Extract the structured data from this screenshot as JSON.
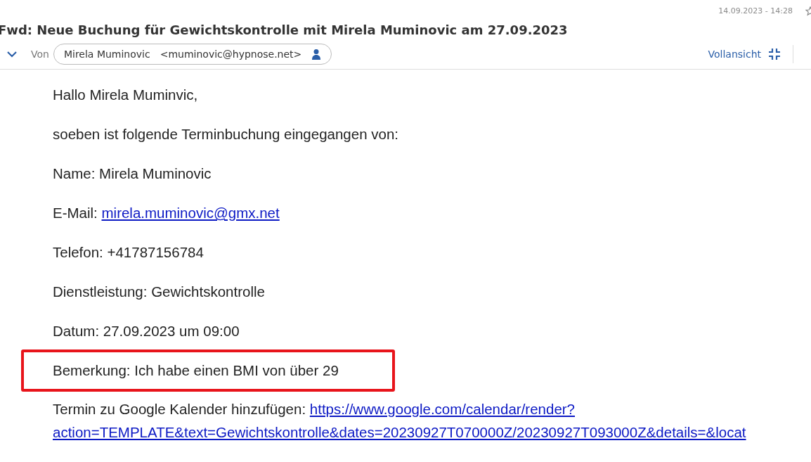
{
  "header": {
    "date": "14.09.2023 - 14:28",
    "subject": "Fwd: Neue Buchung für Gewichtskontrolle mit Mirela Muminovic am 27.09.2023",
    "from_label": "Von",
    "sender_name": "Mirela Muminovic",
    "sender_email": "<muminovic@hypnose.net>",
    "full_view": "Vollansicht"
  },
  "body": [
    {
      "kind": "text",
      "text": "Hallo Mirela Muminvic,",
      "highlighted": false
    },
    {
      "kind": "text",
      "text": "soeben ist folgende Terminbuchung eingegangen von:",
      "highlighted": false
    },
    {
      "kind": "text",
      "text": "Name: Mirela Muminovic",
      "highlighted": false
    },
    {
      "kind": "link",
      "text": "E-Mail:",
      "links": [
        "mirela.muminovic@gmx.net"
      ],
      "highlighted": false
    },
    {
      "kind": "text",
      "text": "Telefon: +41787156784",
      "highlighted": false
    },
    {
      "kind": "text",
      "text": "Dienstleistung: Gewichtskontrolle",
      "highlighted": false
    },
    {
      "kind": "text",
      "text": "Datum: 27.09.2023 um 09:00",
      "highlighted": false
    },
    {
      "kind": "text",
      "text": "Bemerkung: Ich habe einen BMI von über 29",
      "highlighted": true
    },
    {
      "kind": "link",
      "text": "Termin zu Google Kalender hinzufügen:",
      "links": [
        "https://www.google.com/calendar/render?",
        "action=TEMPLATE&text=Gewichtskontrolle&dates=20230927T070000Z/20230927T093000Z&details=&locat"
      ],
      "highlighted": false
    }
  ]
}
